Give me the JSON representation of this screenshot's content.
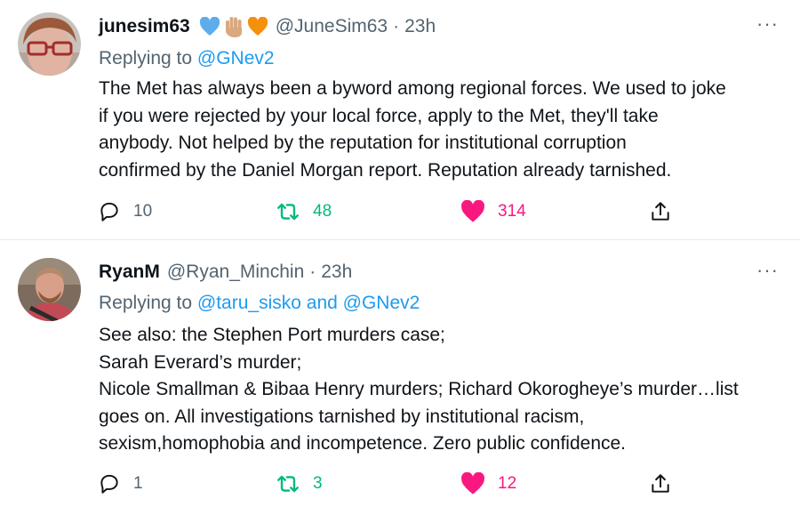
{
  "tweets": [
    {
      "author": {
        "name": "junesim63",
        "handle": "@JuneSim63",
        "badges": [
          "blue-heart-icon",
          "raised-hand-icon",
          "orange-heart-icon"
        ]
      },
      "dot": "·",
      "time": "23h",
      "more": "···",
      "replying": {
        "prefix": "Replying to ",
        "mentions": "@GNev2"
      },
      "lines": [
        "The Met has always been a byword among regional forces. We used to joke",
        "if you were rejected by your local force, apply to the Met, they'll take",
        "anybody. Not helped by the reputation for institutional corruption",
        "confirmed by the Daniel Morgan report. Reputation already tarnished."
      ],
      "actions": {
        "replies": "10",
        "retweets": "48",
        "likes": "314"
      }
    },
    {
      "author": {
        "name": "RyanM",
        "handle": "@Ryan_Minchin",
        "badges": []
      },
      "dot": "·",
      "time": "23h",
      "more": "···",
      "replying": {
        "prefix": "Replying to ",
        "mentions": "@taru_sisko and @GNev2"
      },
      "lines": [
        "See also: the Stephen Port murders case;",
        "Sarah Everard’s murder;",
        "Nicole Smallman & Bibaa Henry murders; Richard Okorogheye’s murder…list",
        "goes on. All investigations tarnished by institutional racism,",
        "sexism,homophobia and incompetence. Zero public confidence."
      ],
      "actions": {
        "replies": "1",
        "retweets": "3",
        "likes": "12"
      }
    }
  ],
  "colors": {
    "text": "#0f1419",
    "secondary": "#536471",
    "link": "#1d9bf0",
    "retweet": "#00ba7c",
    "like": "#f91880",
    "divider": "#e6ecf0"
  }
}
